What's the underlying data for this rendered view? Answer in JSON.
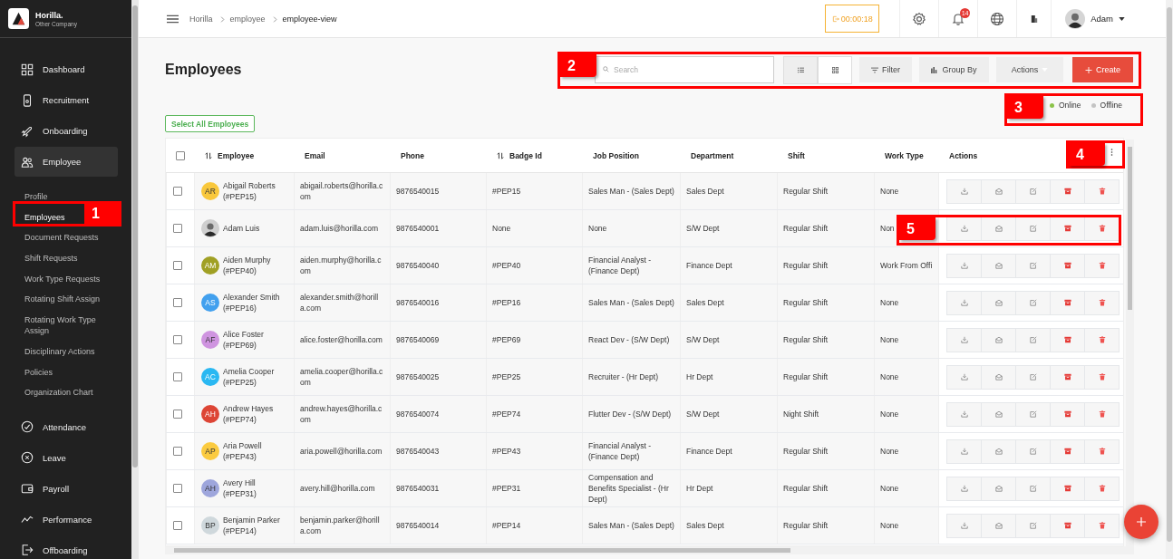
{
  "brand": {
    "name": "Horilla.",
    "company": "Other Company"
  },
  "sidebar": {
    "items": [
      {
        "label": "Dashboard",
        "expanded": false
      },
      {
        "label": "Recruitment",
        "expanded": false
      },
      {
        "label": "Onboarding",
        "expanded": false
      },
      {
        "label": "Employee",
        "expanded": true,
        "children": [
          {
            "label": "Profile",
            "selected": false
          },
          {
            "label": "Employees",
            "selected": true
          },
          {
            "label": "Document Requests",
            "selected": false
          },
          {
            "label": "Shift Requests",
            "selected": false
          },
          {
            "label": "Work Type Requests",
            "selected": false
          },
          {
            "label": "Rotating Shift Assign",
            "selected": false
          },
          {
            "label": "Rotating Work Type Assign",
            "selected": false
          },
          {
            "label": "Disciplinary Actions",
            "selected": false
          },
          {
            "label": "Policies",
            "selected": false
          },
          {
            "label": "Organization Chart",
            "selected": false
          }
        ]
      },
      {
        "label": "Attendance",
        "expanded": false
      },
      {
        "label": "Leave",
        "expanded": false
      },
      {
        "label": "Payroll",
        "expanded": false
      },
      {
        "label": "Performance",
        "expanded": false
      },
      {
        "label": "Offboarding",
        "expanded": false
      }
    ]
  },
  "header": {
    "breadcrumbs": [
      "Horilla",
      "employee",
      "employee-view"
    ],
    "timer": "00:00:18",
    "notification_count": "14",
    "user": "Adam"
  },
  "page": {
    "title": "Employees",
    "search": {
      "placeholder": "Search"
    },
    "views": [
      {
        "selected": true
      },
      {
        "selected": false
      }
    ],
    "buttons": [
      {
        "label": "Filter",
        "kind": "filter"
      },
      {
        "label": "Group By",
        "kind": "group"
      },
      {
        "label": "Actions",
        "kind": "menu"
      },
      {
        "label": "Create",
        "kind": "create"
      }
    ],
    "legend": [
      {
        "label": "Online",
        "color": "#8bc34a"
      },
      {
        "label": "Offline",
        "color": "#c4c4c4"
      }
    ],
    "select_all": "Select All Employees"
  },
  "table": {
    "select_all_checked": false,
    "columns": [
      {
        "label": "Employee",
        "sortable": true
      },
      {
        "label": "Email",
        "sortable": false
      },
      {
        "label": "Phone",
        "sortable": false
      },
      {
        "label": "Badge Id",
        "sortable": true
      },
      {
        "label": "Job Position",
        "sortable": false
      },
      {
        "label": "Department",
        "sortable": false
      },
      {
        "label": "Shift",
        "sortable": false
      },
      {
        "label": "Work Type",
        "sortable": false
      },
      {
        "label": "Actions",
        "sortable": false
      }
    ],
    "rows": [
      {
        "checked": false,
        "avatar": {
          "kind": "initials",
          "initials": "AR",
          "color": "#f9c83c"
        },
        "name": "Abigail Roberts",
        "code": "(#PEP15)",
        "email": "abigail.roberts@horilla.com",
        "phone": "9876540015",
        "badge": "#PEP15",
        "job": "Sales Man - (Sales Dept)",
        "department": "Sales Dept",
        "shift": "Regular Shift",
        "work_type": "None"
      },
      {
        "checked": false,
        "avatar": {
          "kind": "photo"
        },
        "name": "Adam Luis",
        "email": "adam.luis@horilla.com",
        "phone": "9876540001",
        "badge": "None",
        "job": "None",
        "department": "S/W Dept",
        "shift": "Regular Shift",
        "work_type": "Non"
      },
      {
        "checked": false,
        "avatar": {
          "kind": "initials",
          "initials": "AM",
          "color": "#a0a024"
        },
        "name": "Aiden Murphy",
        "code": "(#PEP40)",
        "email": "aiden.murphy@horilla.com",
        "phone": "9876540040",
        "badge": "#PEP40",
        "job": "Financial Analyst - (Finance Dept)",
        "department": "Finance Dept",
        "shift": "Regular Shift",
        "work_type": "Work From Offi"
      },
      {
        "checked": false,
        "avatar": {
          "kind": "initials",
          "initials": "AS",
          "color": "#42a0ee"
        },
        "name": "Alexander Smith",
        "code": "(#PEP16)",
        "email": "alexander.smith@horilla.com",
        "phone": "9876540016",
        "badge": "#PEP16",
        "job": "Sales Man - (Sales Dept)",
        "department": "Sales Dept",
        "shift": "Regular Shift",
        "work_type": "None"
      },
      {
        "checked": false,
        "avatar": {
          "kind": "initials",
          "initials": "AF",
          "color": "#cf94e0"
        },
        "name": "Alice Foster",
        "code": "(#PEP69)",
        "email": "alice.foster@horilla.com",
        "phone": "9876540069",
        "badge": "#PEP69",
        "job": "React Dev - (S/W Dept)",
        "department": "S/W Dept",
        "shift": "Regular Shift",
        "work_type": "None"
      },
      {
        "checked": false,
        "avatar": {
          "kind": "initials",
          "initials": "AC",
          "color": "#2ab8f2"
        },
        "name": "Amelia Cooper",
        "code": "(#PEP25)",
        "email": "amelia.cooper@horilla.com",
        "phone": "9876540025",
        "badge": "#PEP25",
        "job": "Recruiter - (Hr Dept)",
        "department": "Hr Dept",
        "shift": "Regular Shift",
        "work_type": "None"
      },
      {
        "checked": false,
        "avatar": {
          "kind": "initials",
          "initials": "AH",
          "color": "#dd4535"
        },
        "name": "Andrew Hayes",
        "code": "(#PEP74)",
        "email": "andrew.hayes@horilla.com",
        "phone": "9876540074",
        "badge": "#PEP74",
        "job": "Flutter Dev - (S/W Dept)",
        "department": "S/W Dept",
        "shift": "Night Shift",
        "work_type": "None"
      },
      {
        "checked": false,
        "avatar": {
          "kind": "initials",
          "initials": "AP",
          "color": "#fbcb40"
        },
        "name": "Aria Powell",
        "code": "(#PEP43)",
        "email": "aria.powell@horilla.com",
        "phone": "9876540043",
        "badge": "#PEP43",
        "job": "Financial Analyst - (Finance Dept)",
        "department": "Finance Dept",
        "shift": "Regular Shift",
        "work_type": "None"
      },
      {
        "checked": false,
        "avatar": {
          "kind": "initials",
          "initials": "AH",
          "color": "#9ea6dc"
        },
        "name": "Avery Hill",
        "code": "(#PEP31)",
        "email": "avery.hill@horilla.com",
        "phone": "9876540031",
        "badge": "#PEP31",
        "job": "Compensation and Benefits Specialist - (Hr Dept)",
        "department": "Hr Dept",
        "shift": "Regular Shift",
        "work_type": "None"
      },
      {
        "checked": false,
        "avatar": {
          "kind": "initials",
          "initials": "BP",
          "color": "#cfd8dc"
        },
        "name": "Benjamin Parker",
        "code": "(#PEP14)",
        "email": "benjamin.parker@horilla.com",
        "phone": "9876540014",
        "badge": "#PEP14",
        "job": "Sales Man - (Sales Dept)",
        "department": "Sales Dept",
        "shift": "Regular Shift",
        "work_type": "None"
      }
    ]
  },
  "callouts": [
    {
      "number": "1"
    },
    {
      "number": "2"
    },
    {
      "number": "3"
    },
    {
      "number": "4"
    },
    {
      "number": "5"
    }
  ]
}
